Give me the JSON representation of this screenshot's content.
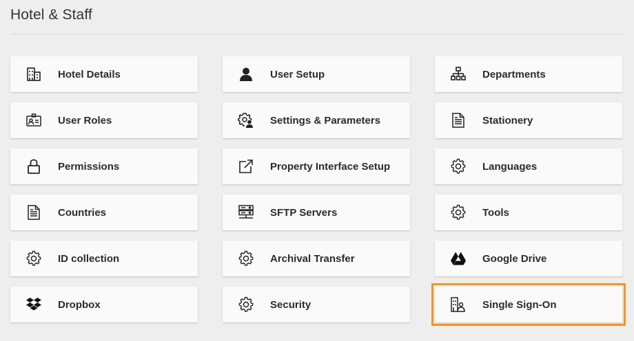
{
  "header": {
    "title": "Hotel & Staff"
  },
  "tiles": [
    {
      "label": "Hotel Details",
      "icon": "building-icon"
    },
    {
      "label": "User Setup",
      "icon": "user-icon"
    },
    {
      "label": "Departments",
      "icon": "org-chart-icon"
    },
    {
      "label": "User Roles",
      "icon": "id-card-icon"
    },
    {
      "label": "Settings & Parameters",
      "icon": "user-gear-icon"
    },
    {
      "label": "Stationery",
      "icon": "document-icon"
    },
    {
      "label": "Permissions",
      "icon": "lock-icon"
    },
    {
      "label": "Property Interface Setup",
      "icon": "external-link-icon"
    },
    {
      "label": "Languages",
      "icon": "gear-icon"
    },
    {
      "label": "Countries",
      "icon": "document-icon"
    },
    {
      "label": "SFTP Servers",
      "icon": "server-icon"
    },
    {
      "label": "Tools",
      "icon": "gear-icon"
    },
    {
      "label": "ID collection",
      "icon": "gear-icon"
    },
    {
      "label": "Archival Transfer",
      "icon": "gear-icon"
    },
    {
      "label": "Google Drive",
      "icon": "google-drive-icon"
    },
    {
      "label": "Dropbox",
      "icon": "dropbox-icon"
    },
    {
      "label": "Security",
      "icon": "gear-icon"
    },
    {
      "label": "Single Sign-On",
      "icon": "sso-building-icon"
    }
  ],
  "highlight": {
    "tile": "Single Sign-On",
    "color": "#f7931e"
  }
}
